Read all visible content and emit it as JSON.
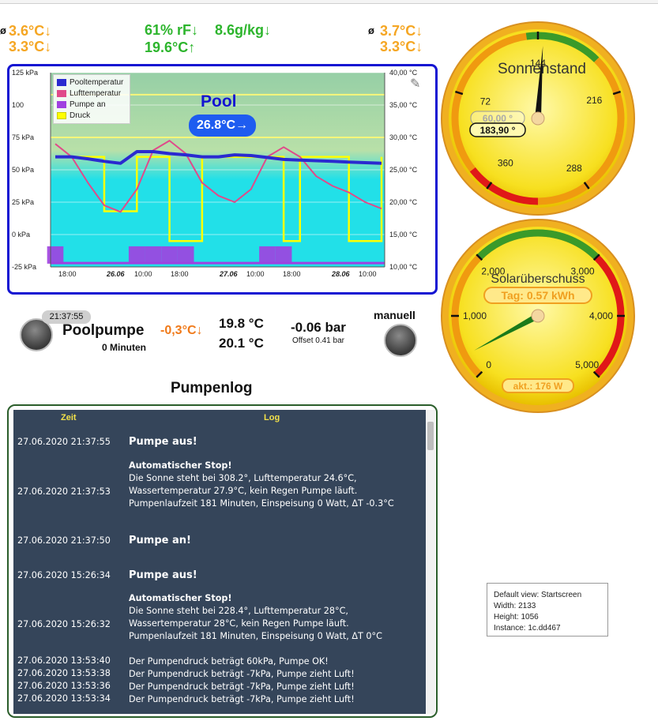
{
  "header": {
    "left_avg_symbol": "ø",
    "left_temp1": "3.6°C↓",
    "left_temp2": "3.3°C↓",
    "humidity": "61% rF↓",
    "abs_humidity": "8.6g/kg↓",
    "air_temp": "19.6°C↑",
    "right_avg_symbol": "ø",
    "right_temp1": "3.7°C↓",
    "right_temp2": "3.3°C↓"
  },
  "pool_chart": {
    "title": "Pool",
    "current_value": "26.8°C→",
    "colors": {
      "pool": "#2a2ad0",
      "luft": "#e04a8a",
      "pumpe": "#a040e0",
      "druck": "#ffff00",
      "band_top": "#96cfa6",
      "band_bottom": "#22e0e8"
    },
    "legend": [
      "Pooltemperatur",
      "Lufttemperatur",
      "Pumpe an",
      "Druck"
    ],
    "left_ticks": [
      "125 kPa",
      "100",
      "75 kPa",
      "50 kPa",
      "25 kPa",
      "0 kPa",
      "-25 kPa"
    ],
    "right_ticks": [
      "40,00 °C",
      "35,00 °C",
      "30,00 °C",
      "25,00 °C",
      "20,00 °C",
      "15,00 °C",
      "10,00 °C"
    ],
    "x_ticks": [
      "18:00",
      "26.06",
      "10:00",
      "18:00",
      "27.06",
      "10:00",
      "18:00",
      "28.06",
      "10:00"
    ],
    "edit_icon": "pencil-icon"
  },
  "chart_data": {
    "type": "line",
    "x": [
      "18:00",
      "26.06",
      "10:00",
      "18:00",
      "27.06",
      "10:00",
      "18:00",
      "28.06",
      "10:00"
    ],
    "series": [
      {
        "name": "Pooltemperatur",
        "unit": "°C",
        "values": [
          27.0,
          27.0,
          26.7,
          26.3,
          26.0,
          27.8,
          27.8,
          27.5,
          27.3,
          27.0,
          27.0,
          27.3,
          27.2,
          26.9,
          26.6,
          26.5,
          26.4,
          26.3,
          26.2,
          26.1,
          26.0
        ]
      },
      {
        "name": "Lufttemperatur",
        "unit": "°C",
        "values": [
          29.0,
          27.0,
          23.0,
          19.5,
          18.5,
          22.0,
          28.0,
          29.5,
          27.5,
          23.0,
          21.0,
          20.0,
          22.0,
          27.0,
          28.5,
          27.0,
          24.0,
          22.5,
          21.5,
          20.0,
          19.0
        ]
      },
      {
        "name": "Druck",
        "unit": "kPa",
        "values": [
          60,
          60,
          60,
          18,
          18,
          60,
          60,
          -5,
          -5,
          60,
          60,
          60,
          60,
          60,
          -5,
          60,
          60,
          60,
          -5,
          -5,
          60
        ]
      },
      {
        "name": "Pumpe an",
        "unit": "",
        "values": [
          1,
          0,
          0,
          0,
          0,
          1,
          1,
          1,
          1,
          0,
          0,
          0,
          0,
          1,
          1,
          0,
          0,
          0,
          0,
          0,
          0
        ]
      }
    ],
    "y_left_range": [
      -25,
      125
    ],
    "y_right_range": [
      10,
      40
    ],
    "legend_position": "top-left"
  },
  "status": {
    "time": "21:37:55",
    "pump_label": "Poolpumpe",
    "delta": "-0,3°C↓",
    "minutes": "0 Minuten",
    "temp_in": "19.8 °C",
    "temp_out": "20.1 °C",
    "pressure": "-0.06 bar",
    "offset": "Offset 0.41 bar",
    "mode": "manuell"
  },
  "gauge_sun": {
    "title": "Sonnenstand",
    "value_ghost": "60,00 °",
    "value": "183,90 °",
    "ticks": [
      "72",
      "144",
      "216",
      "288",
      "360"
    ],
    "needle_deg": 183.9
  },
  "gauge_solar": {
    "title": "Solarüberschuss",
    "day_label": "Tag: 0.57 kWh",
    "current_label": "akt.: 176 W",
    "ticks": [
      "0",
      "1,000",
      "2,000",
      "3,000",
      "4,000",
      "5,000"
    ],
    "current_w": 176
  },
  "log": {
    "title": "Pumpenlog",
    "col_time": "Zeit",
    "col_log": "Log",
    "entries": [
      {
        "time": "27.06.2020 21:37:55",
        "text": "Pumpe aus!"
      },
      {
        "time": "27.06.2020 21:37:53",
        "head": "Automatischer Stop!",
        "l1": "Die Sonne steht bei 308.2°, Lufttemperatur 24.6°C,",
        "l2": "Wassertemperatur 27.9°C, kein Regen Pumpe läuft.",
        "l3": "Pumpenlaufzeit 181 Minuten, Einspeisung 0 Watt, ΔT -0.3°C"
      },
      {
        "time": "27.06.2020 21:37:50",
        "text": "Pumpe an!"
      },
      {
        "time": "27.06.2020 15:26:34",
        "text": "Pumpe aus!"
      },
      {
        "time": "27.06.2020 15:26:32",
        "head": "Automatischer Stop!",
        "l1": "Die Sonne steht bei 228.4°, Lufttemperatur 28°C,",
        "l2": "Wassertemperatur 28°C, kein Regen Pumpe läuft.",
        "l3": "Pumpenlaufzeit 181 Minuten, Einspeisung 0 Watt, ΔT 0°C"
      },
      {
        "time": "27.06.2020 13:53:40",
        "msg": "Der Pumpendruck beträgt 60kPa, Pumpe OK!"
      },
      {
        "time": "27.06.2020 13:53:38",
        "msg": "Der Pumpendruck beträgt -7kPa, Pumpe zieht Luft!"
      },
      {
        "time": "27.06.2020 13:53:36",
        "msg": "Der Pumpendruck beträgt -7kPa, Pumpe zieht Luft!"
      },
      {
        "time": "27.06.2020 13:53:34",
        "msg": "Der Pumpendruck beträgt -7kPa, Pumpe zieht Luft!"
      }
    ]
  },
  "info": {
    "line1": "Default view: Startscreen",
    "line2": "Width: 2133",
    "line3": "Height: 1056",
    "line4": "Instance: 1c.dd467"
  }
}
